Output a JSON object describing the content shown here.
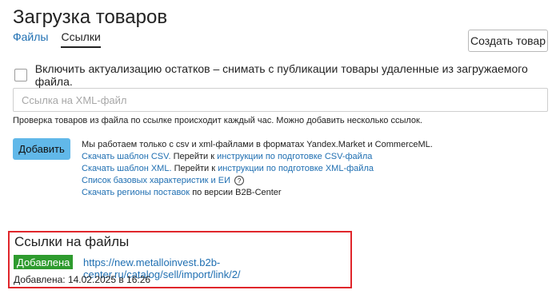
{
  "page": {
    "title": "Загрузка товаров"
  },
  "tabs": [
    {
      "label": "Файлы"
    },
    {
      "label": "Ссылки"
    }
  ],
  "create_button": {
    "label": "Создать товар"
  },
  "checkbox": {
    "label": "Включить актуализацию остатков – снимать с публикации товары удаленные из загружаемого файла.",
    "checked": false
  },
  "xml_input": {
    "placeholder": "Ссылка на XML-файл",
    "value": ""
  },
  "hint": "Проверка товаров из файла по ссылке происходит каждый час. Можно добавить несколько ссылок.",
  "add_button": {
    "label": "Добавить"
  },
  "info": {
    "line1": "Мы работаем только с csv и xml-файлами в форматах Yandex.Market и CommerceML.",
    "csv_template": "Скачать шаблон CSV.",
    "goto": "Перейти к",
    "csv_instructions": "инструкции по подготовке CSV-файла",
    "xml_template": "Скачать шаблон XML.",
    "xml_instructions": "инструкции по подготовке XML-файла",
    "basic_list": "Список базовых характеристик и ЕИ",
    "help_icon": "question-icon",
    "download_regions": "Скачать регионы поставок",
    "regions_suffix": "по версии B2B-Center"
  },
  "files_section": {
    "title": "Ссылки на файлы",
    "status_badge": "Добавлена",
    "link": "https://new.metalloinvest.b2b-center.ru/catalog/sell/import/link/2/",
    "added_label": "Добавлена: 14.02.2025 в 16:26"
  },
  "colors": {
    "link": "#1f6fb2",
    "primary_button": "#61b8e9",
    "badge_green": "#2e9b2e",
    "highlight_border": "#e0262b"
  }
}
